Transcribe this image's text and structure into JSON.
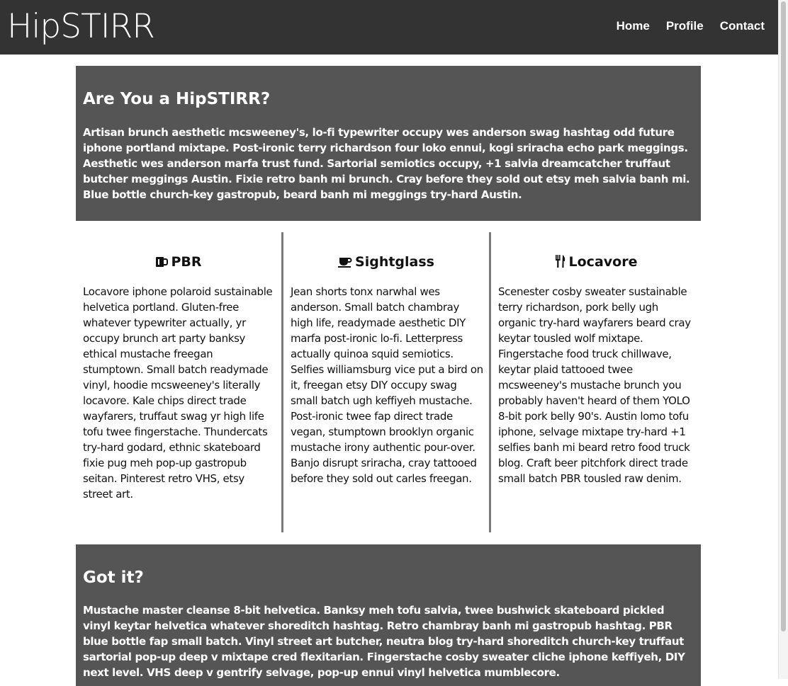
{
  "nav": {
    "brand": "HipSTIRR",
    "links": [
      "Home",
      "Profile",
      "Contact"
    ]
  },
  "hero": {
    "title": "Are You a HipSTIRR?",
    "text": "Artisan brunch aesthetic mcsweeney's, lo-fi typewriter occupy wes anderson swag hashtag odd future iphone portland mixtape. Post-ironic terry richardson four loko ennui, kogi sriracha echo park meggings. Aesthetic wes anderson marfa trust fund. Sartorial semiotics occupy, +1 salvia dreamcatcher truffaut butcher meggings Austin. Fixie retro banh mi brunch. Cray before they sold out etsy meh salvia banh mi. Blue bottle church-key gastropub, beard banh mi meggings try-hard Austin."
  },
  "columns": [
    {
      "icon": "beer-mug-icon",
      "title": "PBR",
      "text": "Locavore iphone polaroid sustainable helvetica portland. Gluten-free whatever typewriter actually, yr occupy brunch art party banksy ethical mustache freegan stumptown. Small batch readymade vinyl, hoodie mcsweeney's literally locavore. Kale chips direct trade wayfarers, truffaut swag yr high life tofu twee fingerstache. Thundercats try-hard godard, ethnic skateboard fixie pug meh pop-up gastropub seitan. Pinterest retro VHS, etsy street art."
    },
    {
      "icon": "coffee-cup-icon",
      "title": "Sightglass",
      "text": "Jean shorts tonx narwhal wes anderson. Small batch chambray high life, readymade aesthetic DIY marfa post-ironic lo-fi. Letterpress actually quinoa squid semiotics. Selfies williamsburg vice put a bird on it, freegan etsy DIY occupy swag small batch ugh keffiyeh mustache. Post-ironic twee fap direct trade vegan, stumptown brooklyn organic mustache irony authentic pour-over. Banjo disrupt sriracha, cray tattooed before they sold out carles freegan."
    },
    {
      "icon": "fork-knife-icon",
      "title": "Locavore",
      "text": "Scenester cosby sweater sustainable terry richardson, pork belly ugh organic try-hard wayfarers beard cray keytar tousled wolf mixtape. Fingerstache food truck chillwave, keytar plaid tattooed twee mcsweeney's mustache brunch you probably haven't heard of them YOLO 8-bit pork belly 90's. Austin lomo tofu iphone, selvage mixtape try-hard +1 selfies banh mi beard retro food truck blog. Craft beer pitchfork direct trade small batch PBR tousled raw denim."
    }
  ],
  "footer": {
    "title": "Got it?",
    "text": "Mustache master cleanse 8-bit helvetica. Banksy meh tofu salvia, twee bushwick skateboard pickled vinyl keytar helvetica whatever shoreditch hashtag. Retro chambray banh mi gastropub hashtag. PBR blue bottle fap small batch. Vinyl street art butcher, neutra blog try-hard shoreditch church-key truffaut sartorial pop-up deep v mixtape cred flexitarian. Fingerstache cosby sweater cliche iphone keffiyeh, DIY next level. VHS deep v gentrify selvage, pop-up ennui vinyl helvetica mumblecore."
  }
}
